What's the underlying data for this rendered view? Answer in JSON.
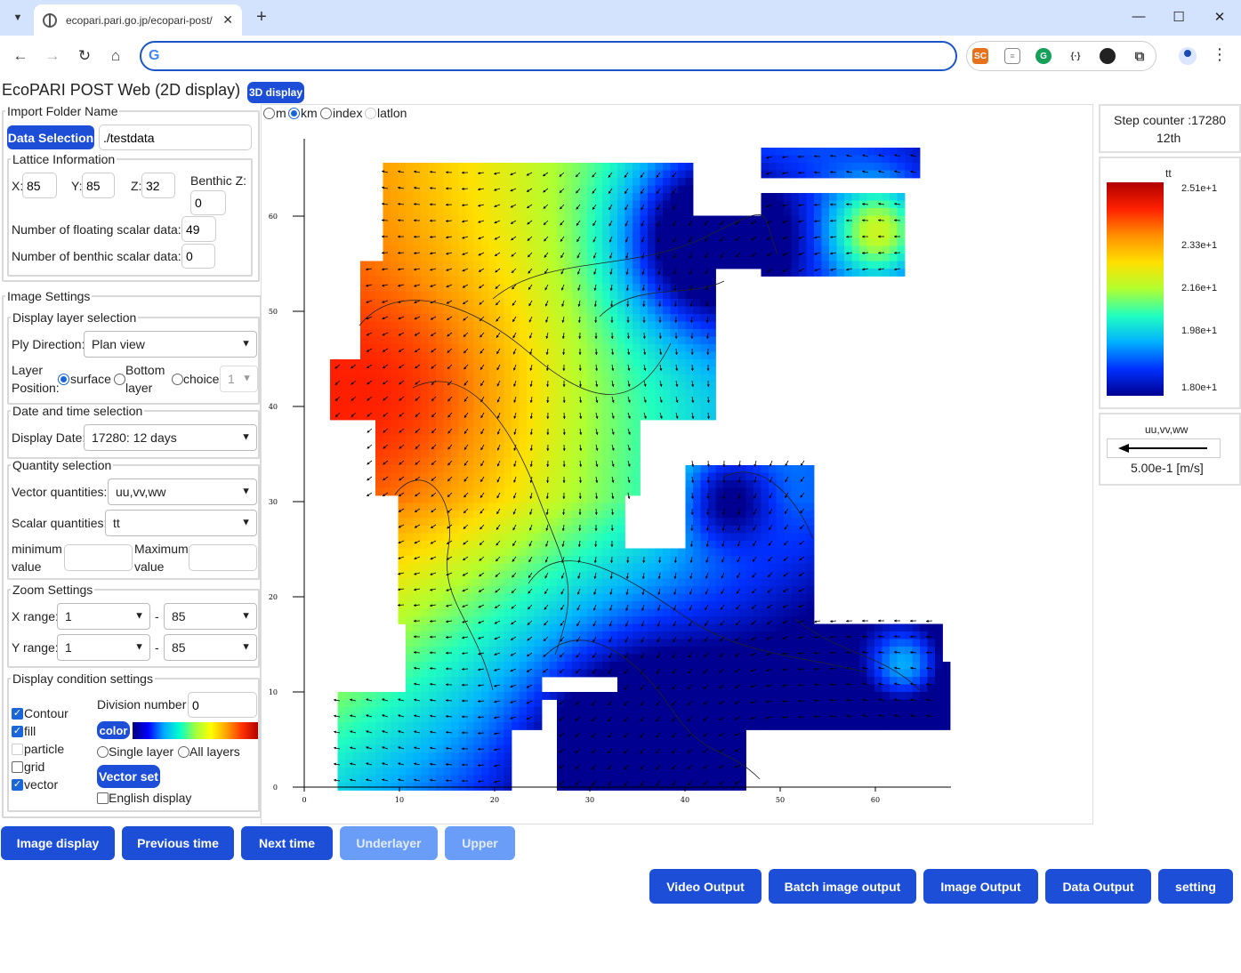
{
  "browser": {
    "tab_title": "ecopari.pari.go.jp/ecopari-post/",
    "address": ""
  },
  "app": {
    "title": "EcoPARI POST Web (2D display)",
    "btn_3d": "3D display"
  },
  "import": {
    "legend": "Import Folder Name",
    "data_selection": "Data Selection",
    "folder": "./testdata"
  },
  "lattice": {
    "legend": "Lattice Information",
    "x_label": "X:",
    "x": "85",
    "y_label": "Y:",
    "y": "85",
    "z_label": "Z:",
    "z": "32",
    "bz_label": "Benthic Z:",
    "bz": "0",
    "float_label": "Number of floating scalar data:",
    "float": "49",
    "benthic_label": "Number of benthic scalar data:",
    "benthic": "0"
  },
  "image": {
    "legend": "Image Settings",
    "layer_legend": "Display layer selection",
    "ply_label": "Ply Direction:",
    "ply": "Plan view",
    "layer_label_1": "Layer",
    "layer_label_2": "Position:",
    "surface": "surface",
    "bottom_1": "Bottom",
    "bottom_2": "layer",
    "choice": "choice",
    "choice_val": "1",
    "date_legend": "Date and time selection",
    "date_label": "Display Date:",
    "date": "17280: 12 days",
    "qty_legend": "Quantity selection",
    "vec_label": "Vector quantities:",
    "vec": "uu,vv,ww",
    "scal_label": "Scalar quantities:",
    "scal": "tt",
    "min_1": "minimum",
    "min_2": "value",
    "max_1": "Maximum",
    "max_2": "value",
    "zoom_legend": "Zoom Settings",
    "xr_label": "X range:",
    "x_from": "1",
    "x_to": "85",
    "yr_label": "Y range:",
    "y_from": "1",
    "y_to": "85",
    "dash": "-",
    "cond_legend": "Display condition settings",
    "contour": "Contour",
    "fill": "fill",
    "particle": "particle",
    "grid": "grid",
    "vector": "vector",
    "div_label": "Division number",
    "div": "0",
    "color": "color",
    "single": "Single layer",
    "all": "All layers",
    "vector_set": "Vector set",
    "english": "English display"
  },
  "units": {
    "m": "m",
    "km": "km",
    "index": "index",
    "latlon": "latlon"
  },
  "step": {
    "line1": "Step counter :17280",
    "line2": "12th"
  },
  "colorbar": {
    "title": "tt",
    "ticks": [
      "2.51e+1",
      "2.33e+1",
      "2.16e+1",
      "1.98e+1",
      "1.80e+1"
    ]
  },
  "vector_legend": {
    "title": "uu,vv,ww",
    "value": "5.00e-1  [m/s]"
  },
  "plot": {
    "x_ticks": [
      "0",
      "10",
      "20",
      "30",
      "40",
      "50",
      "60"
    ],
    "y_ticks": [
      "0",
      "10",
      "20",
      "30",
      "40",
      "50",
      "60"
    ]
  },
  "buttons": {
    "image_display": "Image display",
    "previous": "Previous time",
    "next": "Next time",
    "underlayer": "Underlayer",
    "upper": "Upper",
    "video": "Video Output",
    "batch": "Batch image output",
    "image_out": "Image Output",
    "data_out": "Data Output",
    "setting": "setting"
  }
}
